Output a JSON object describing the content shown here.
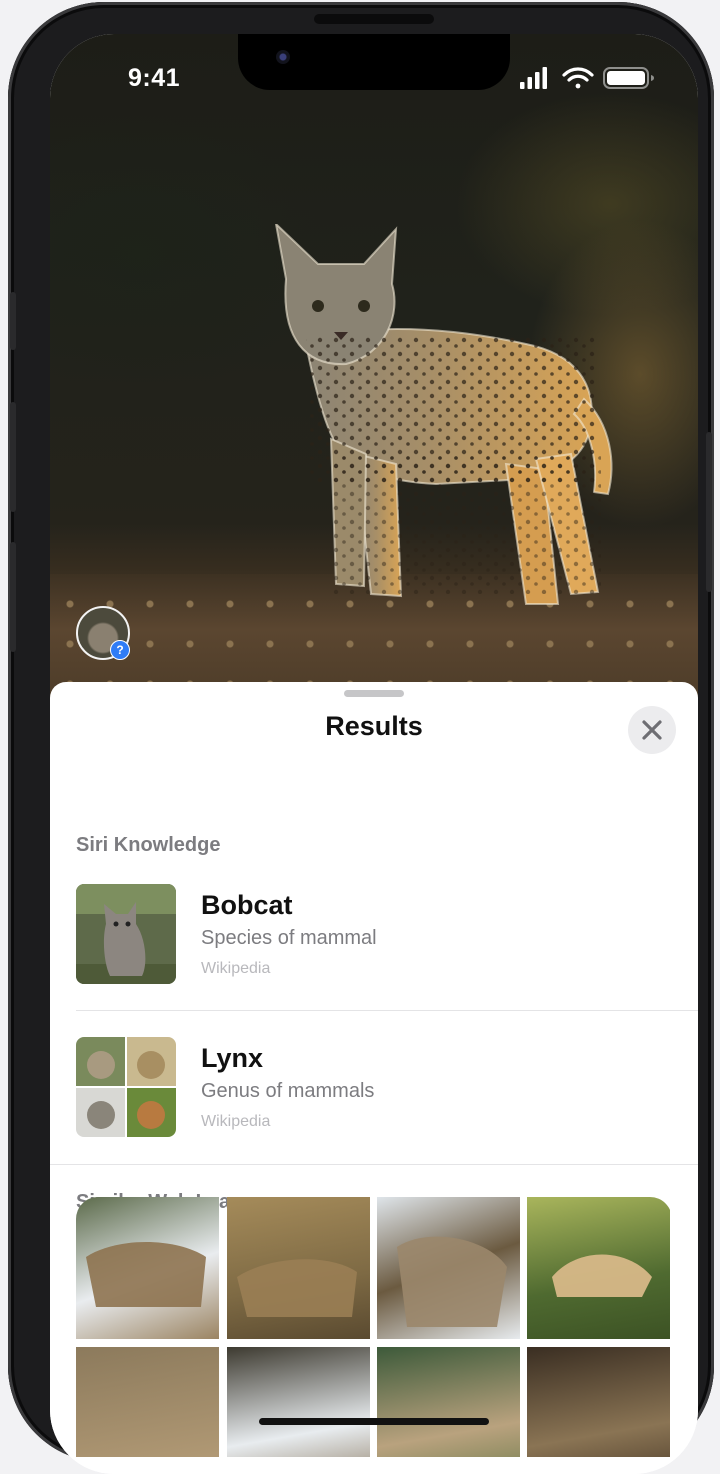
{
  "status_bar": {
    "time": "9:41"
  },
  "sheet": {
    "title": "Results",
    "close_icon": "close-icon"
  },
  "siri_knowledge": {
    "label": "Siri Knowledge",
    "results": [
      {
        "title": "Bobcat",
        "subtitle": "Species of mammal",
        "source": "Wikipedia"
      },
      {
        "title": "Lynx",
        "subtitle": "Genus of mammals",
        "source": "Wikipedia"
      }
    ]
  },
  "similar_web_images": {
    "label": "Similar Web Images",
    "image_count_visible": 8
  },
  "colors": {
    "accent_badge": "#2f7cf6",
    "secondary_text": "#7c7c80",
    "tertiary_text": "#b8b8bc"
  }
}
